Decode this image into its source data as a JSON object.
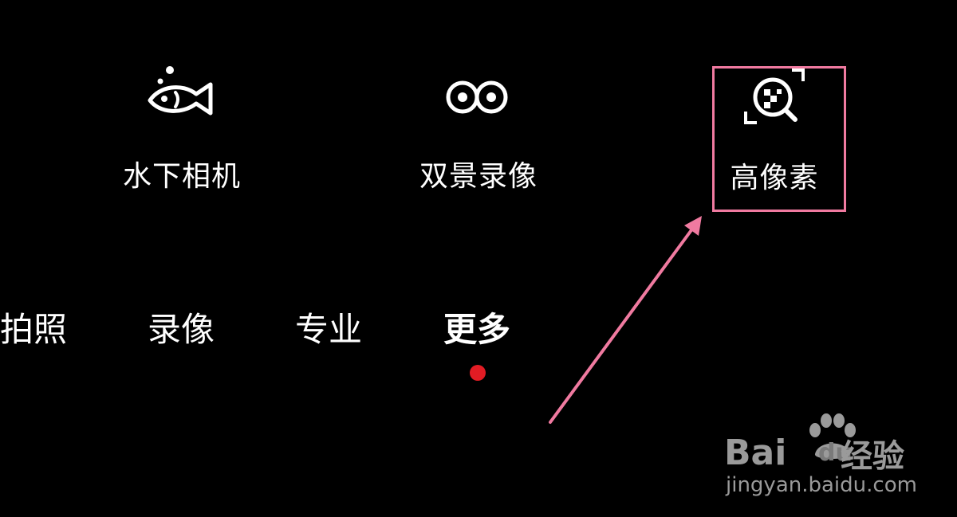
{
  "modes": [
    {
      "label": "水下相机",
      "icon": "fish-icon"
    },
    {
      "label": "双景录像",
      "icon": "dual-view-icon"
    },
    {
      "label": "高像素",
      "icon": "high-pixel-icon"
    }
  ],
  "tabs": [
    {
      "label": "拍照",
      "active": false
    },
    {
      "label": "录像",
      "active": false
    },
    {
      "label": "专业",
      "active": false
    },
    {
      "label": "更多",
      "active": true
    }
  ],
  "annotation": {
    "highlight_color": "#f07aa0",
    "arrow_color": "#f07aa0",
    "target": "高像素"
  },
  "indicator_color": "#e21c24",
  "watermark": {
    "brand_a": "Bai",
    "brand_b": "du",
    "brand_c": "经验",
    "domain": "jingyan.baidu.com"
  }
}
